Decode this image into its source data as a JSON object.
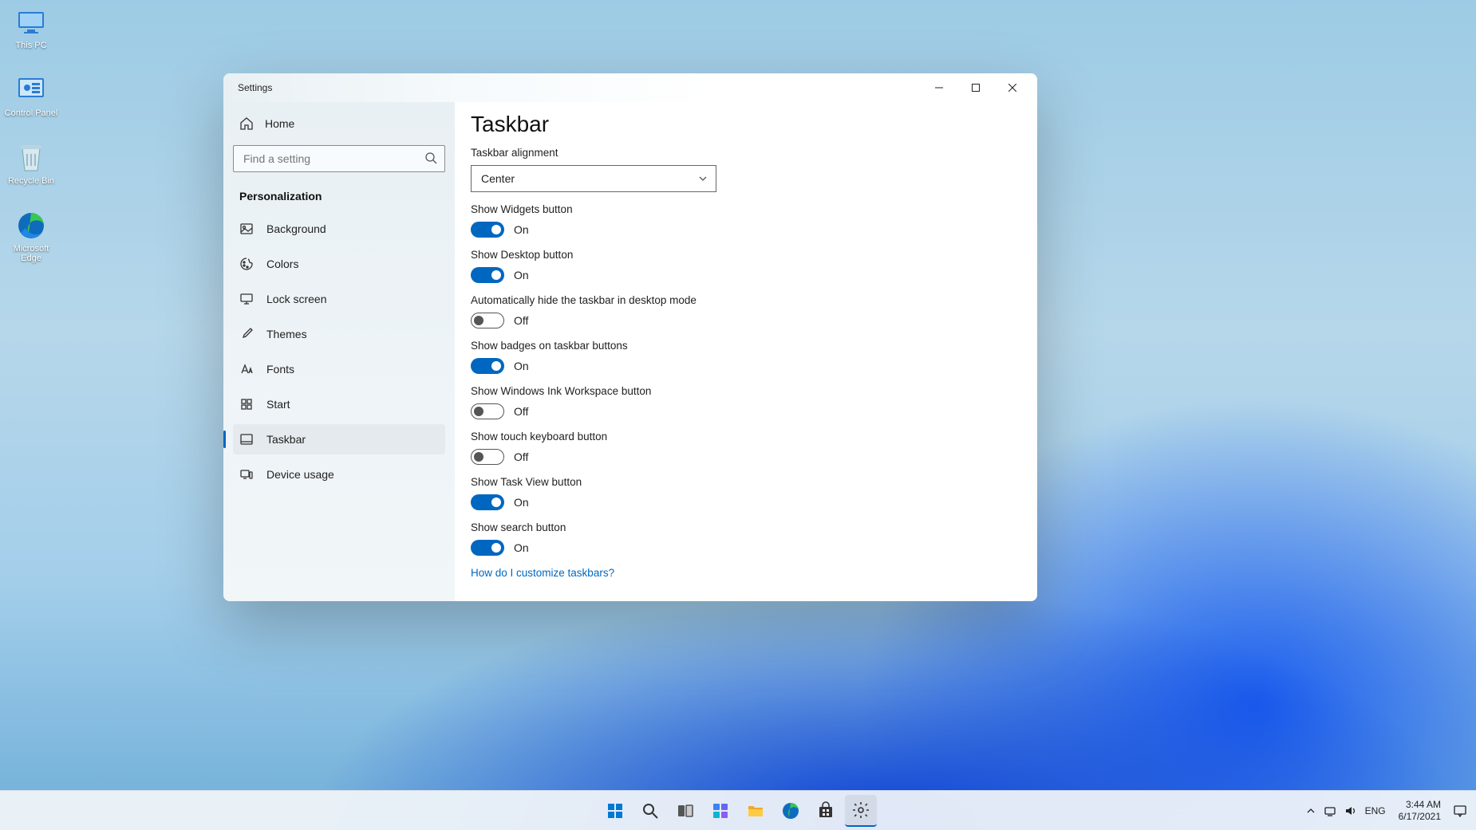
{
  "desktop_icons": [
    {
      "id": "this-pc",
      "label": "This PC"
    },
    {
      "id": "control-panel",
      "label": "Control Panel"
    },
    {
      "id": "recycle-bin",
      "label": "Recycle Bin"
    },
    {
      "id": "edge",
      "label": "Microsoft Edge"
    }
  ],
  "window": {
    "title": "Settings",
    "sidebar": {
      "home_label": "Home",
      "search_placeholder": "Find a setting",
      "section_header": "Personalization",
      "items": [
        {
          "id": "background",
          "label": "Background",
          "icon": "image-icon"
        },
        {
          "id": "colors",
          "label": "Colors",
          "icon": "palette-icon"
        },
        {
          "id": "lock-screen",
          "label": "Lock screen",
          "icon": "monitor-icon"
        },
        {
          "id": "themes",
          "label": "Themes",
          "icon": "brush-icon"
        },
        {
          "id": "fonts",
          "label": "Fonts",
          "icon": "font-icon"
        },
        {
          "id": "start",
          "label": "Start",
          "icon": "grid-icon"
        },
        {
          "id": "taskbar",
          "label": "Taskbar",
          "icon": "taskbar-icon",
          "active": true
        },
        {
          "id": "device-usage",
          "label": "Device usage",
          "icon": "device-icon"
        }
      ]
    },
    "content": {
      "heading": "Taskbar",
      "alignment": {
        "label": "Taskbar alignment",
        "value": "Center"
      },
      "toggles": [
        {
          "id": "widgets",
          "label": "Show Widgets button",
          "state": "On"
        },
        {
          "id": "desktop",
          "label": "Show Desktop button",
          "state": "On"
        },
        {
          "id": "autohide",
          "label": "Automatically hide the taskbar in desktop mode",
          "state": "Off"
        },
        {
          "id": "badges",
          "label": "Show badges on taskbar buttons",
          "state": "On"
        },
        {
          "id": "ink",
          "label": "Show Windows Ink Workspace button",
          "state": "Off"
        },
        {
          "id": "touchkb",
          "label": "Show touch keyboard button",
          "state": "Off"
        },
        {
          "id": "taskview",
          "label": "Show Task View button",
          "state": "On"
        },
        {
          "id": "search",
          "label": "Show search button",
          "state": "On"
        }
      ],
      "help_link": "How do I customize taskbars?"
    }
  },
  "taskbar": {
    "apps": [
      {
        "id": "start",
        "icon": "start-icon"
      },
      {
        "id": "search",
        "icon": "search-icon"
      },
      {
        "id": "taskview",
        "icon": "taskview-icon"
      },
      {
        "id": "widgets",
        "icon": "widgets-icon"
      },
      {
        "id": "explorer",
        "icon": "folder-icon"
      },
      {
        "id": "edge",
        "icon": "edge-icon"
      },
      {
        "id": "store",
        "icon": "store-icon"
      },
      {
        "id": "settings",
        "icon": "settings-icon",
        "active": true
      }
    ],
    "tray": {
      "lang": "ENG"
    },
    "clock": {
      "time": "3:44 AM",
      "date": "6/17/2021"
    }
  }
}
